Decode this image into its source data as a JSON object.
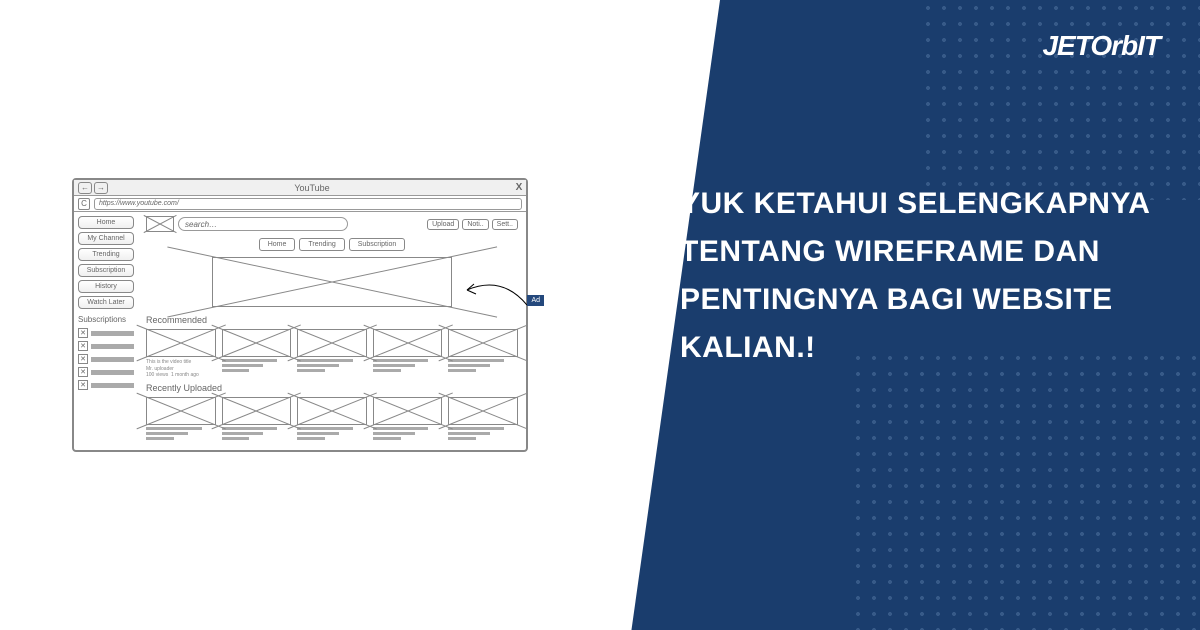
{
  "brand": {
    "logo_text": "JETOrbIT"
  },
  "headline": "YUK KETAHUI SELENGKAPNYA TENTANG WIREFRAME DAN PENTINGNYA BAGI WEBSITE KALIAN.!",
  "wireframe": {
    "window_title": "YouTube",
    "close_label": "X",
    "back_label": "←",
    "forward_label": "→",
    "reload_label": "C",
    "url": "https://www.youtube.com/",
    "search_placeholder": "search…",
    "top_buttons": {
      "upload": "Upload",
      "noti": "Noti..",
      "sett": "Sett.."
    },
    "tabs": [
      "Home",
      "Trending",
      "Subscription"
    ],
    "ad_label": "Ad",
    "sections": {
      "recommended": "Recommended",
      "recent": "Recently Uploaded"
    },
    "card_meta": {
      "title": "This is the video title",
      "uploader": "Mr. uploader",
      "views": "100 views",
      "age": "1 month ago"
    },
    "sidebar": {
      "items": [
        "Home",
        "My Channel",
        "Trending",
        "Subscription",
        "History",
        "Watch Later"
      ],
      "subs_title": "Subscriptions",
      "sub_x": "✕"
    }
  }
}
